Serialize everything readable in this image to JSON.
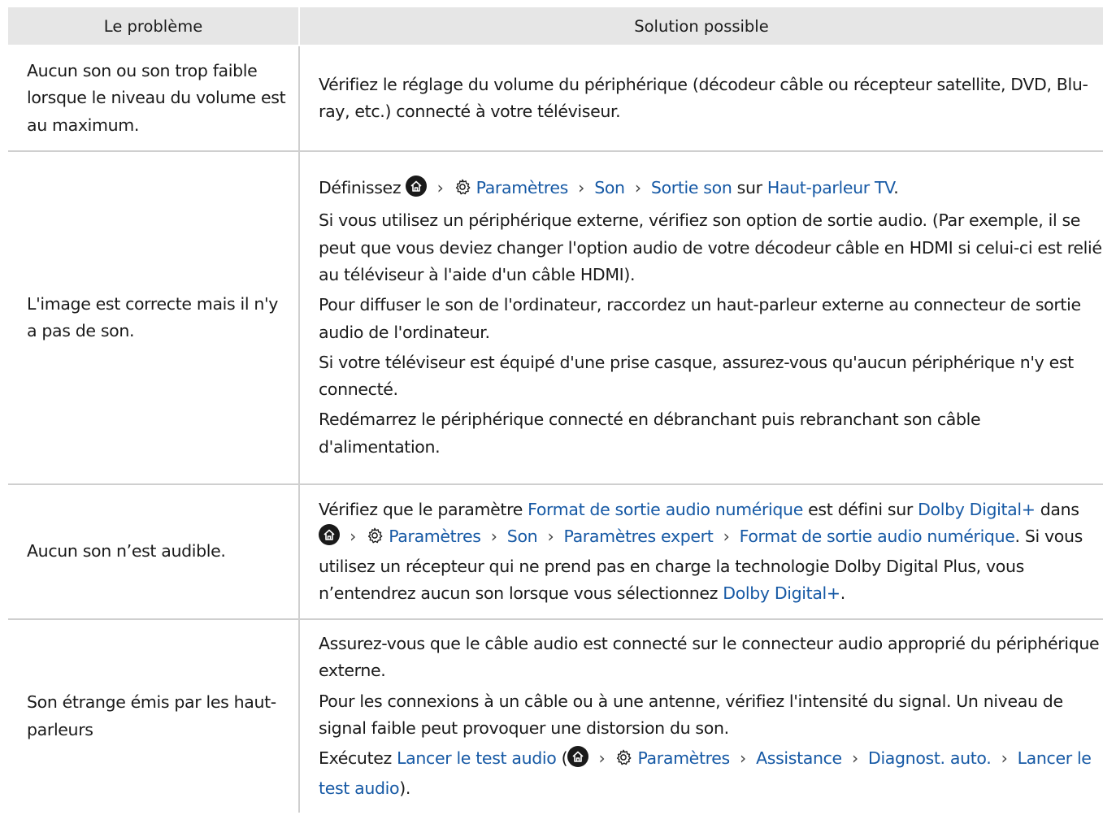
{
  "table": {
    "header": {
      "problem": "Le problème",
      "solution": "Solution possible"
    },
    "rows": [
      {
        "problem": "Aucun son ou son trop faible lorsque le niveau du volume est au maximum.",
        "solution": [
          "Vérifiez le réglage du volume du périphérique (décodeur câble ou récepteur satellite, DVD, Blu-ray, etc.) connecté à votre téléviseur."
        ]
      },
      {
        "problem": "L'image est correcte mais il n'y a pas de son.",
        "menu_path": {
          "prefix": "Définissez",
          "settings": "Paramètres",
          "son": "Son",
          "sortie_son": "Sortie son",
          "on": "sur",
          "target": "Haut-parleur TV",
          "end": "."
        },
        "solution": [
          "Si vous utilisez un périphérique externe, vérifiez son option de sortie audio. (Par exemple, il se peut que vous deviez changer l'option audio de votre décodeur câble en HDMI si celui-ci est relié au téléviseur à l'aide d'un câble HDMI).",
          "Pour diffuser le son de l'ordinateur, raccordez un haut-parleur externe au connecteur de sortie audio de l'ordinateur.",
          "Si votre téléviseur est équipé d'une prise casque, assurez-vous qu'aucun périphérique n'y est connecté.",
          "Redémarrez le périphérique connecté en débranchant puis rebranchant son câble d'alimentation."
        ]
      },
      {
        "problem": "Aucun son n’est audible.",
        "solution_parts": {
          "t1": "Vérifiez que le paramètre ",
          "link1": "Format de sortie audio numérique",
          "t2": " est défini sur ",
          "link2": "Dolby Digital+",
          "t3": " dans ",
          "settings": "Paramètres",
          "son": "Son",
          "expert": "Paramètres expert",
          "format": "Format de sortie audio numérique",
          "t4": ". Si vous utilisez un récepteur qui ne prend pas en charge la technologie Dolby Digital Plus, vous n’entendrez aucun son lorsque vous sélectionnez ",
          "link3": "Dolby Digital+",
          "t5": "."
        }
      },
      {
        "problem": "Son étrange émis par les haut-parleurs",
        "solution": [
          "Assurez-vous que le câble audio est connecté sur le connecteur audio approprié du périphérique externe.",
          "Pour les connexions à un câble ou à une antenne, vérifiez l'intensité du signal. Un niveau de signal faible peut provoquer une distorsion du son."
        ],
        "test_path": {
          "prefix": "Exécutez ",
          "link": "Lancer le test audio",
          "open": " (",
          "settings": "Paramètres",
          "assistance": "Assistance",
          "diag": "Diagnost. auto.",
          "link_end": "Lancer le test audio",
          "close": ")."
        }
      }
    ]
  },
  "icons": {
    "home": "home-icon",
    "settings": "gear-icon",
    "chevron": "chevron-right-icon"
  },
  "colors": {
    "link": "#1659a5",
    "header_bg": "#e6e6e6",
    "row_divider": "#cfcfcf"
  }
}
